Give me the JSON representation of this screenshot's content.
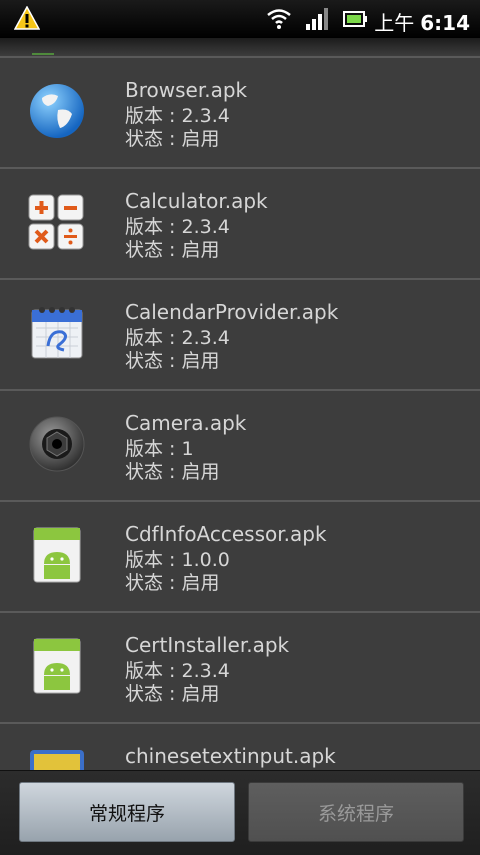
{
  "status_bar": {
    "time_prefix": "上午",
    "time": "6:14",
    "icons": [
      "warning-icon",
      "wifi-icon",
      "signal-icon",
      "battery-icon"
    ]
  },
  "apps": [
    {
      "name": "Browser.apk",
      "version": "版本 : 2.3.4",
      "state": "状态 : 启用",
      "icon": "globe-icon"
    },
    {
      "name": "Calculator.apk",
      "version": "版本 : 2.3.4",
      "state": "状态 : 启用",
      "icon": "calculator-icon"
    },
    {
      "name": "CalendarProvider.apk",
      "version": "版本 : 2.3.4",
      "state": "状态 : 启用",
      "icon": "calendar-icon"
    },
    {
      "name": "Camera.apk",
      "version": "版本 : 1",
      "state": "状态 : 启用",
      "icon": "camera-icon"
    },
    {
      "name": "CdfInfoAccessor.apk",
      "version": "版本 : 1.0.0",
      "state": "状态 : 启用",
      "icon": "android-icon"
    },
    {
      "name": "CertInstaller.apk",
      "version": "版本 : 2.3.4",
      "state": "状态 : 启用",
      "icon": "android-icon"
    },
    {
      "name": "chinesetextinput.apk",
      "version": "",
      "state": "",
      "icon": "input-method-icon"
    }
  ],
  "tabs": {
    "regular": "常规程序",
    "system": "系统程序"
  },
  "colors": {
    "background": "#3d3d3d",
    "text": "#d6d6d6",
    "active_tab": "#b8c1ca"
  }
}
